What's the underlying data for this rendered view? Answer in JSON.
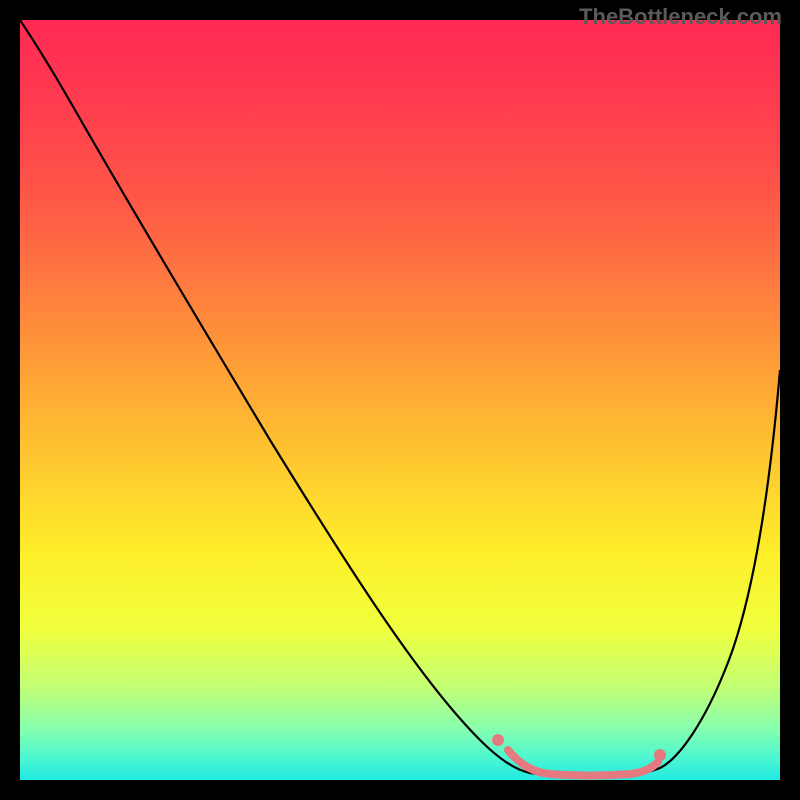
{
  "watermark": "TheBottleneck.com",
  "chart_data": {
    "type": "line",
    "title": "",
    "xlabel": "",
    "ylabel": "",
    "xlim": [
      0,
      100
    ],
    "ylim": [
      0,
      100
    ],
    "grid": false,
    "legend": false,
    "background_gradient": {
      "direction": "vertical",
      "stops": [
        {
          "pos": 0,
          "color": "#ff2a54"
        },
        {
          "pos": 25,
          "color": "#fe5b46"
        },
        {
          "pos": 55,
          "color": "#febe31"
        },
        {
          "pos": 80,
          "color": "#f1ff3e"
        },
        {
          "pos": 100,
          "color": "#22eae2"
        }
      ]
    },
    "series": [
      {
        "name": "curve",
        "color": "#000000",
        "x": [
          0,
          5,
          10,
          15,
          20,
          25,
          30,
          35,
          40,
          45,
          50,
          55,
          60,
          63,
          67,
          70,
          74,
          78,
          82,
          85,
          90,
          95,
          100
        ],
        "y": [
          100,
          95,
          89,
          82,
          75,
          67,
          59,
          51,
          43,
          35,
          26,
          18,
          10,
          5,
          1.5,
          0.6,
          0.5,
          0.5,
          0.6,
          2,
          10,
          30,
          55
        ]
      }
    ],
    "highlight_segment": {
      "color": "#e47a7f",
      "x_start": 63,
      "x_end": 85,
      "y": 0.5,
      "end_dots": [
        {
          "x": 63,
          "y": 5
        },
        {
          "x": 85,
          "y": 2
        }
      ]
    }
  }
}
